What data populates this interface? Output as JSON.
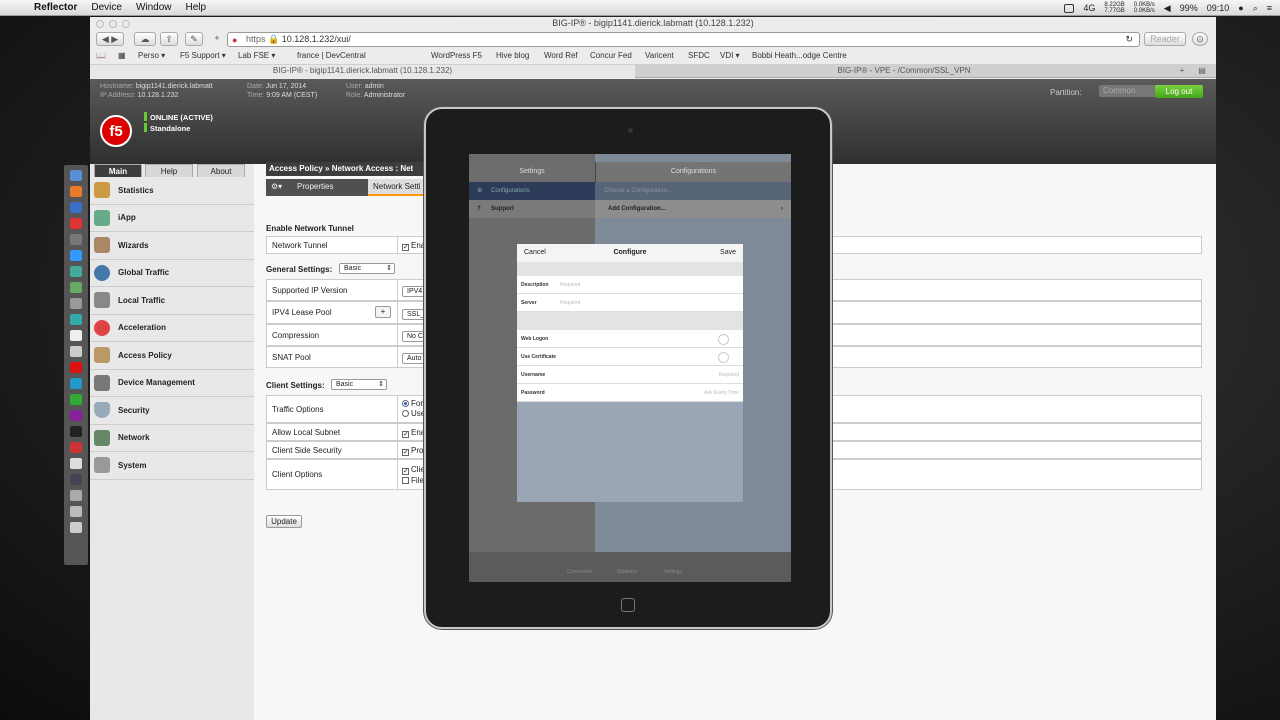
{
  "menubar": {
    "app": "Reflector",
    "items": [
      "Device",
      "Window",
      "Help"
    ],
    "net_up": "0.0KB/s",
    "net_down": "0.0KB/s",
    "disk_u": "8.22GB",
    "disk_f": "7.77GB",
    "network": "4G",
    "battery": "99%",
    "clock": "09:10"
  },
  "window": {
    "title": "BIG-IP® - bigip1141.dierick.labmatt (10.128.1.232)"
  },
  "toolbar": {
    "url_scheme": "https",
    "url_rest": "10.128.1.232/xui/",
    "reader": "Reader"
  },
  "bookmarks": [
    "Perso ▾",
    "F5 Support ▾",
    "Lab FSE ▾",
    "france | DevCentral",
    "WordPress F5",
    "Hive blog",
    "Word Ref",
    "Concur Fed",
    "Varicent",
    "SFDC",
    "VDI ▾",
    "Bobbi Heath...odge Centre"
  ],
  "tabs": {
    "left": "BIG-IP® - bigip1141.dierick.labmatt (10.128.1.232)",
    "right": "BIG-IP® - VPE - /Common/SSL_VPN"
  },
  "header": {
    "hostname_label": "Hostname:",
    "hostname": "bigip1141.dierick.labmatt",
    "ip_label": "IP Address:",
    "ip": "10.128.1.232",
    "date_label": "Date:",
    "date": "Jun 17, 2014",
    "time_label": "Time:",
    "time": "9:09 AM (CEST)",
    "user_label": "User:",
    "user": "admin",
    "role_label": "Role:",
    "role": "Administrator",
    "partition_label": "Partition:",
    "partition": "Common",
    "logout": "Log out",
    "status1": "ONLINE (ACTIVE)",
    "status2": "Standalone"
  },
  "nav": {
    "tabs": [
      "Main",
      "Help",
      "About"
    ],
    "items": [
      "Statistics",
      "iApp",
      "Wizards",
      "Global Traffic",
      "Local Traffic",
      "Acceleration",
      "Access Policy",
      "Device Management",
      "Security",
      "Network",
      "System"
    ]
  },
  "content": {
    "breadcrumb": "Access Policy  »  Network Access : Net",
    "subtabs": [
      "Properties",
      "Network Setti"
    ],
    "sections": {
      "tunnel": "Enable Network Tunnel",
      "general": "General Settings:",
      "client": "Client Settings:"
    },
    "general_mode": "Basic",
    "client_mode": "Basic",
    "rows": {
      "network_tunnel": {
        "label": "Network Tunnel",
        "value": "Ena"
      },
      "ip_version": {
        "label": "Supported IP Version",
        "value": "IPV4"
      },
      "lease_pool": {
        "label": "IPV4 Lease Pool",
        "value": "SSL_V"
      },
      "compression": {
        "label": "Compression",
        "value": "No C"
      },
      "snat": {
        "label": "SNAT Pool",
        "value": "Auto"
      },
      "traffic_options": {
        "label": "Traffic Options",
        "value1": "Forc",
        "value2": "Use"
      },
      "local_subnet": {
        "label": "Allow Local Subnet",
        "value": "Ena"
      },
      "client_security": {
        "label": "Client Side Security",
        "value": "Proh"
      },
      "client_options": {
        "label": "Client Options",
        "value1": "Clie",
        "value2": "File"
      }
    },
    "update": "Update"
  },
  "ipad": {
    "left_title": "Settings",
    "right_title": "Configurations",
    "left_items": [
      "Configurations",
      "Support"
    ],
    "choose": "Choose a Configuration...",
    "add": "Add Configuration...",
    "modal": {
      "cancel": "Cancel",
      "title": "Configure",
      "save": "Save",
      "description": "Description",
      "server": "Server",
      "required": "Required",
      "web_logon": "Web Logon",
      "use_cert": "Use Certificate",
      "username": "Username",
      "password": "Password",
      "ask": "Ask Every Time"
    },
    "bottom": [
      "Connection",
      "Statistics",
      "Settings"
    ]
  }
}
